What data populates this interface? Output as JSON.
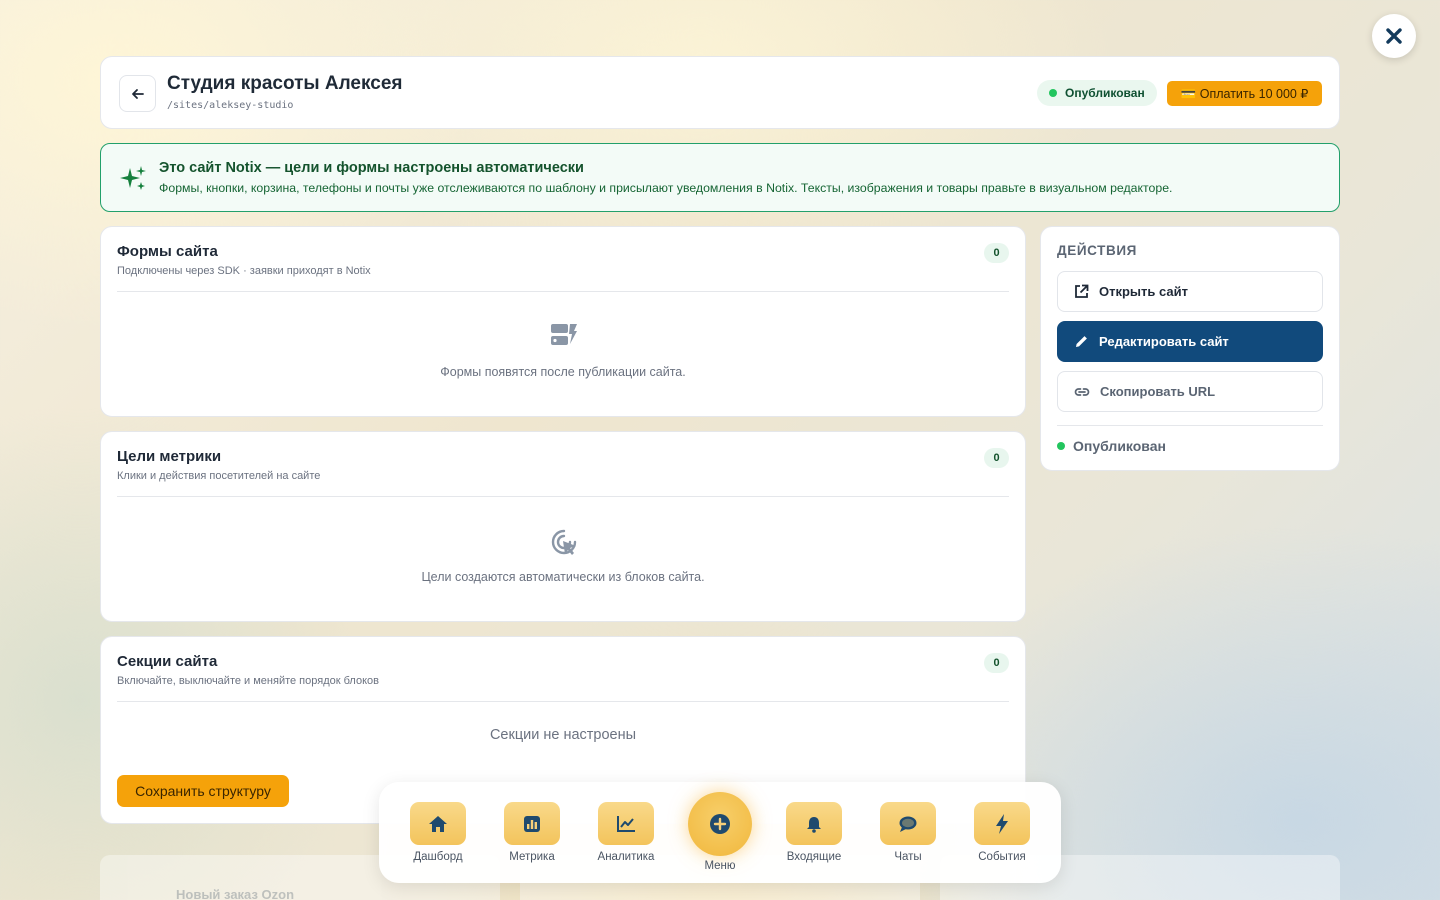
{
  "background": {
    "ghost_text": "Новый заказ Ozon"
  },
  "header": {
    "title": "Студия красоты Алексея",
    "path": "/sites/aleksey-studio",
    "status": "Опубликован",
    "pay_label": "💳 Оплатить 10 000 ₽"
  },
  "notice": {
    "title": "Это сайт Notix — цели и формы настроены автоматически",
    "text": "Формы, кнопки, корзина, телефоны и почты уже отслеживаются по шаблону и присылают уведомления в Notix. Тексты, изображения и товары правьте в визуальном редакторе."
  },
  "forms": {
    "title": "Формы сайта",
    "subtitle": "Подключены через SDK · заявки приходят в Notix",
    "count": "0",
    "empty": "Формы появятся после публикации сайта.",
    "icon": "forms-bolt-icon"
  },
  "goals": {
    "title": "Цели метрики",
    "subtitle": "Клики и действия посетителей на сайте",
    "count": "0",
    "empty": "Цели создаются автоматически из блоков сайта.",
    "icon": "click-target-icon"
  },
  "sections": {
    "title": "Секции сайта",
    "subtitle": "Включайте, выключайте и меняйте порядок блоков",
    "count": "0",
    "empty": "Секции не настроены",
    "save_label": "Сохранить структуру"
  },
  "actions": {
    "title": "ДЕЙСТВИЯ",
    "open": "Открыть сайт",
    "edit": "Редактировать сайт",
    "copy": "Скопировать URL",
    "status": "Опубликован"
  },
  "dock": {
    "items": [
      {
        "label": "Дашборд",
        "icon": "home-icon"
      },
      {
        "label": "Метрика",
        "icon": "metrics-icon"
      },
      {
        "label": "Аналитика",
        "icon": "analytics-icon"
      },
      {
        "label": "Меню",
        "icon": "plus-circle-icon"
      },
      {
        "label": "Входящие",
        "icon": "bell-icon"
      },
      {
        "label": "Чаты",
        "icon": "chat-icon"
      },
      {
        "label": "События",
        "icon": "bolt-icon"
      }
    ]
  },
  "colors": {
    "accent": "#f5a20a",
    "primary": "#114a7c",
    "success": "#22c55e",
    "notice_border": "#22a06b"
  }
}
